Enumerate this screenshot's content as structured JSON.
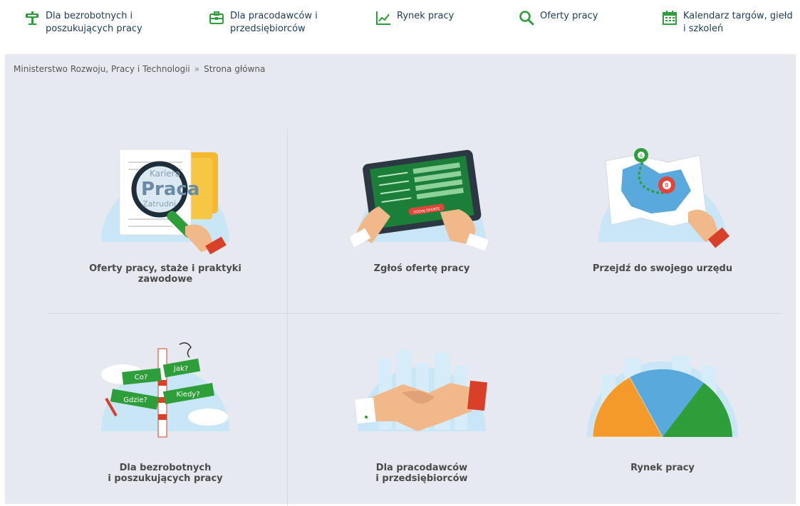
{
  "nav": {
    "items": [
      {
        "line1": "Dla bezrobotnych i",
        "line2": "poszukujących pracy",
        "icon": "signpost-icon"
      },
      {
        "line1": "Dla pracodawców i",
        "line2": "przedsiębiorców",
        "icon": "briefcase-icon"
      },
      {
        "line1": "Rynek pracy",
        "line2": "",
        "icon": "chart-icon"
      },
      {
        "line1": "Oferty pracy",
        "line2": "",
        "icon": "search-icon"
      },
      {
        "line1": "Kalendarz targów, giełd",
        "line2": "i szkoleń",
        "icon": "calendar-icon"
      }
    ],
    "accent": "#2e9e3a"
  },
  "breadcrumb": {
    "root": "Ministerstwo Rozwoju, Pracy i Technologii",
    "separator": "»",
    "current": "Strona główna"
  },
  "tiles": [
    {
      "line1": "Oferty pracy, staże i praktyki",
      "line2": "zawodowe",
      "image_words": [
        "Kariera",
        "Praca",
        "Zatrudni"
      ]
    },
    {
      "line1": "Zgłoś ofertę pracy",
      "line2": "",
      "screen_button": "DODAJ OFERTĘ"
    },
    {
      "line1": "Przejdź do swojego urzędu",
      "line2": "",
      "pin_a": "A",
      "pin_b": "B"
    },
    {
      "line1": "Dla bezrobotnych",
      "line2": "i poszukujących pracy",
      "signs": [
        "Co?",
        "Jak?",
        "Kiedy?",
        "Gdzie?"
      ]
    },
    {
      "line1": "Dla pracodawców",
      "line2": "i przedsiębiorców"
    },
    {
      "line1": "Rynek pracy",
      "line2": ""
    }
  ]
}
